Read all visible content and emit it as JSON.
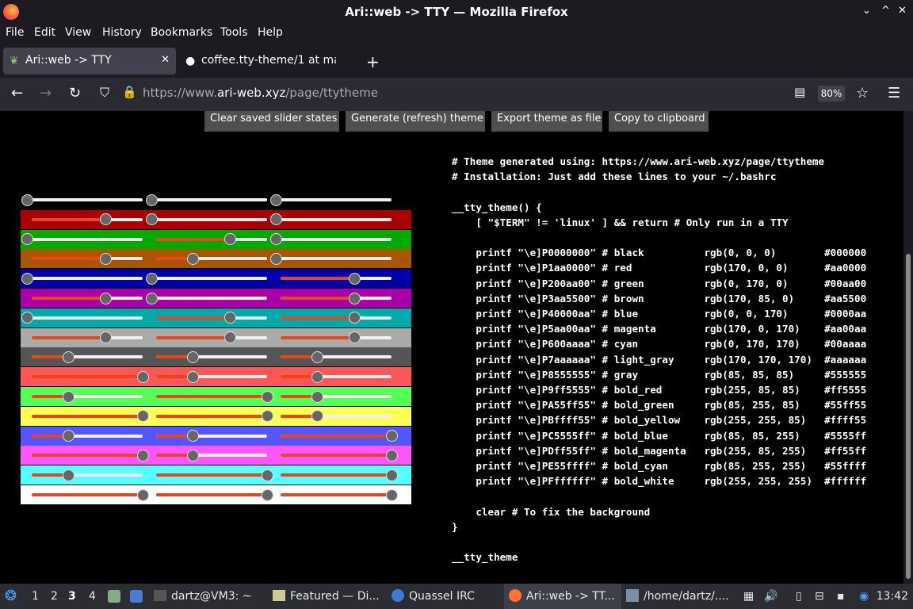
{
  "window": {
    "title": "Ari::web -> TTY — Mozilla Firefox",
    "minimize": "⌄",
    "maximize": "^",
    "close": "✕"
  },
  "menu": [
    "File",
    "Edit",
    "View",
    "History",
    "Bookmarks",
    "Tools",
    "Help"
  ],
  "tabs": [
    {
      "label": "Ari::web -> TTY",
      "icon": "leaf-icon"
    },
    {
      "label": "coffee.tty-theme/1 at ma",
      "icon": "github-icon"
    }
  ],
  "nav": {
    "url_prefix": "https://www.",
    "url_domain": "ari-web.xyz",
    "url_path": "/page/ttytheme",
    "zoom": "80%"
  },
  "page": {
    "buttons": [
      "Clear saved slider states",
      "Generate (refresh) theme",
      "Export theme as file",
      "Copy to clipboard"
    ],
    "colors": [
      {
        "name": "black",
        "hex": "#000000",
        "r": 0,
        "g": 0,
        "b": 0
      },
      {
        "name": "red",
        "hex": "#aa0000",
        "r": 170,
        "g": 0,
        "b": 0
      },
      {
        "name": "green",
        "hex": "#00aa00",
        "r": 0,
        "g": 170,
        "b": 0
      },
      {
        "name": "brown",
        "hex": "#aa5500",
        "r": 170,
        "g": 85,
        "b": 0
      },
      {
        "name": "blue",
        "hex": "#0000aa",
        "r": 0,
        "g": 0,
        "b": 170
      },
      {
        "name": "magenta",
        "hex": "#aa00aa",
        "r": 170,
        "g": 0,
        "b": 170
      },
      {
        "name": "cyan",
        "hex": "#00aaaa",
        "r": 0,
        "g": 170,
        "b": 170
      },
      {
        "name": "light_gray",
        "hex": "#aaaaaa",
        "r": 170,
        "g": 170,
        "b": 170
      },
      {
        "name": "gray",
        "hex": "#555555",
        "r": 85,
        "g": 85,
        "b": 85
      },
      {
        "name": "bold_red",
        "hex": "#ff5555",
        "r": 255,
        "g": 85,
        "b": 85
      },
      {
        "name": "bold_green",
        "hex": "#55ff55",
        "r": 85,
        "g": 255,
        "b": 85
      },
      {
        "name": "bold_yellow",
        "hex": "#ffff55",
        "r": 255,
        "g": 255,
        "b": 85
      },
      {
        "name": "bold_blue",
        "hex": "#5555ff",
        "r": 85,
        "g": 85,
        "b": 255
      },
      {
        "name": "bold_magenta",
        "hex": "#ff55ff",
        "r": 255,
        "g": 85,
        "b": 255
      },
      {
        "name": "bold_cyan",
        "hex": "#55ffff",
        "r": 85,
        "g": 255,
        "b": 255
      },
      {
        "name": "bold_white",
        "hex": "#ffffff",
        "r": 255,
        "g": 255,
        "b": 255
      }
    ],
    "code": [
      "# Theme generated using: https://www.ari-web.xyz/page/ttytheme",
      "# Installation: Just add these lines to your ~/.bashrc",
      "",
      "__tty_theme() {",
      "    [ \"$TERM\" != 'linux' ] && return # Only run in a TTY",
      "",
      "    printf \"\\e]P0000000\" # black          rgb(0, 0, 0)        #000000",
      "    printf \"\\e]P1aa0000\" # red            rgb(170, 0, 0)      #aa0000",
      "    printf \"\\e]P200aa00\" # green          rgb(0, 170, 0)      #00aa00",
      "    printf \"\\e]P3aa5500\" # brown          rgb(170, 85, 0)     #aa5500",
      "    printf \"\\e]P40000aa\" # blue           rgb(0, 0, 170)      #0000aa",
      "    printf \"\\e]P5aa00aa\" # magenta        rgb(170, 0, 170)    #aa00aa",
      "    printf \"\\e]P600aaaa\" # cyan           rgb(0, 170, 170)    #00aaaa",
      "    printf \"\\e]P7aaaaaa\" # light_gray     rgb(170, 170, 170)  #aaaaaa",
      "    printf \"\\e]P8555555\" # gray           rgb(85, 85, 85)     #555555",
      "    printf \"\\e]P9ff5555\" # bold_red       rgb(255, 85, 85)    #ff5555",
      "    printf \"\\e]PA55ff55\" # bold_green     rgb(85, 255, 85)    #55ff55",
      "    printf \"\\e]PBffff55\" # bold_yellow    rgb(255, 255, 85)   #ffff55",
      "    printf \"\\e]PC5555ff\" # bold_blue      rgb(85, 85, 255)    #5555ff",
      "    printf \"\\e]PDff55ff\" # bold_magenta   rgb(255, 85, 255)   #ff55ff",
      "    printf \"\\e]PE55ffff\" # bold_cyan      rgb(85, 255, 255)   #55ffff",
      "    printf \"\\e]PFffffff\" # bold_white     rgb(255, 255, 255)  #ffffff",
      "",
      "    clear # To fix the background",
      "}",
      "",
      "__tty_theme"
    ]
  },
  "taskbar": {
    "workspaces": [
      "1",
      "2",
      "3",
      "4"
    ],
    "active_workspace": "3",
    "items": [
      {
        "label": "dartz@VM3: ~",
        "icon": "terminal-icon"
      },
      {
        "label": "Featured — Di...",
        "icon": "store-icon"
      },
      {
        "label": "Quassel IRC",
        "icon": "irc-icon"
      },
      {
        "label": "Ari::web -> TT...",
        "icon": "firefox-icon"
      },
      {
        "label": "/home/dartz/....",
        "icon": "editor-icon"
      }
    ],
    "clock": "13:42"
  }
}
